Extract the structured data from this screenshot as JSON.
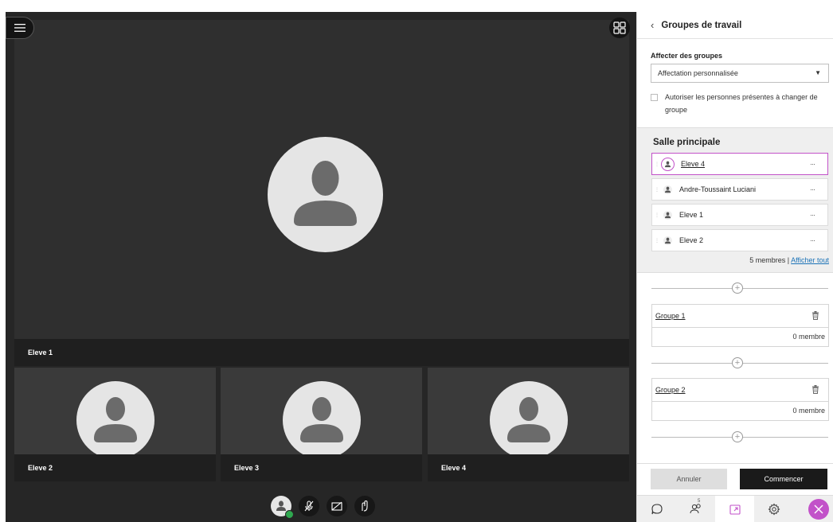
{
  "stage": {
    "main_name": "Eleve 1",
    "tiles": [
      {
        "name": "Eleve 2"
      },
      {
        "name": "Eleve 3"
      },
      {
        "name": "Eleve 4"
      }
    ]
  },
  "panel": {
    "title": "Groupes de travail",
    "assign_label": "Affecter des groupes",
    "assign_value": "Affectation personnalisée",
    "allow_switch_label": "Autoriser les personnes présentes à changer de groupe",
    "main_room": {
      "title": "Salle principale",
      "members": [
        {
          "name": "Eleve 4"
        },
        {
          "name": "Andre-Toussaint Luciani"
        },
        {
          "name": "Eleve 1"
        },
        {
          "name": "Eleve 2"
        }
      ],
      "count": "5 membres",
      "separator": "|",
      "show_all": "Afficher tout"
    },
    "groups": [
      {
        "name": "Groupe 1",
        "count": "0 membre"
      },
      {
        "name": "Groupe 2",
        "count": "0 membre"
      }
    ],
    "cancel_label": "Annuler",
    "start_label": "Commencer",
    "attendees_badge": "5"
  },
  "colors": {
    "accent": "#c252c9",
    "link": "#1b72b7",
    "stage_bg": "#262626",
    "ok_green": "#2fa84f"
  }
}
